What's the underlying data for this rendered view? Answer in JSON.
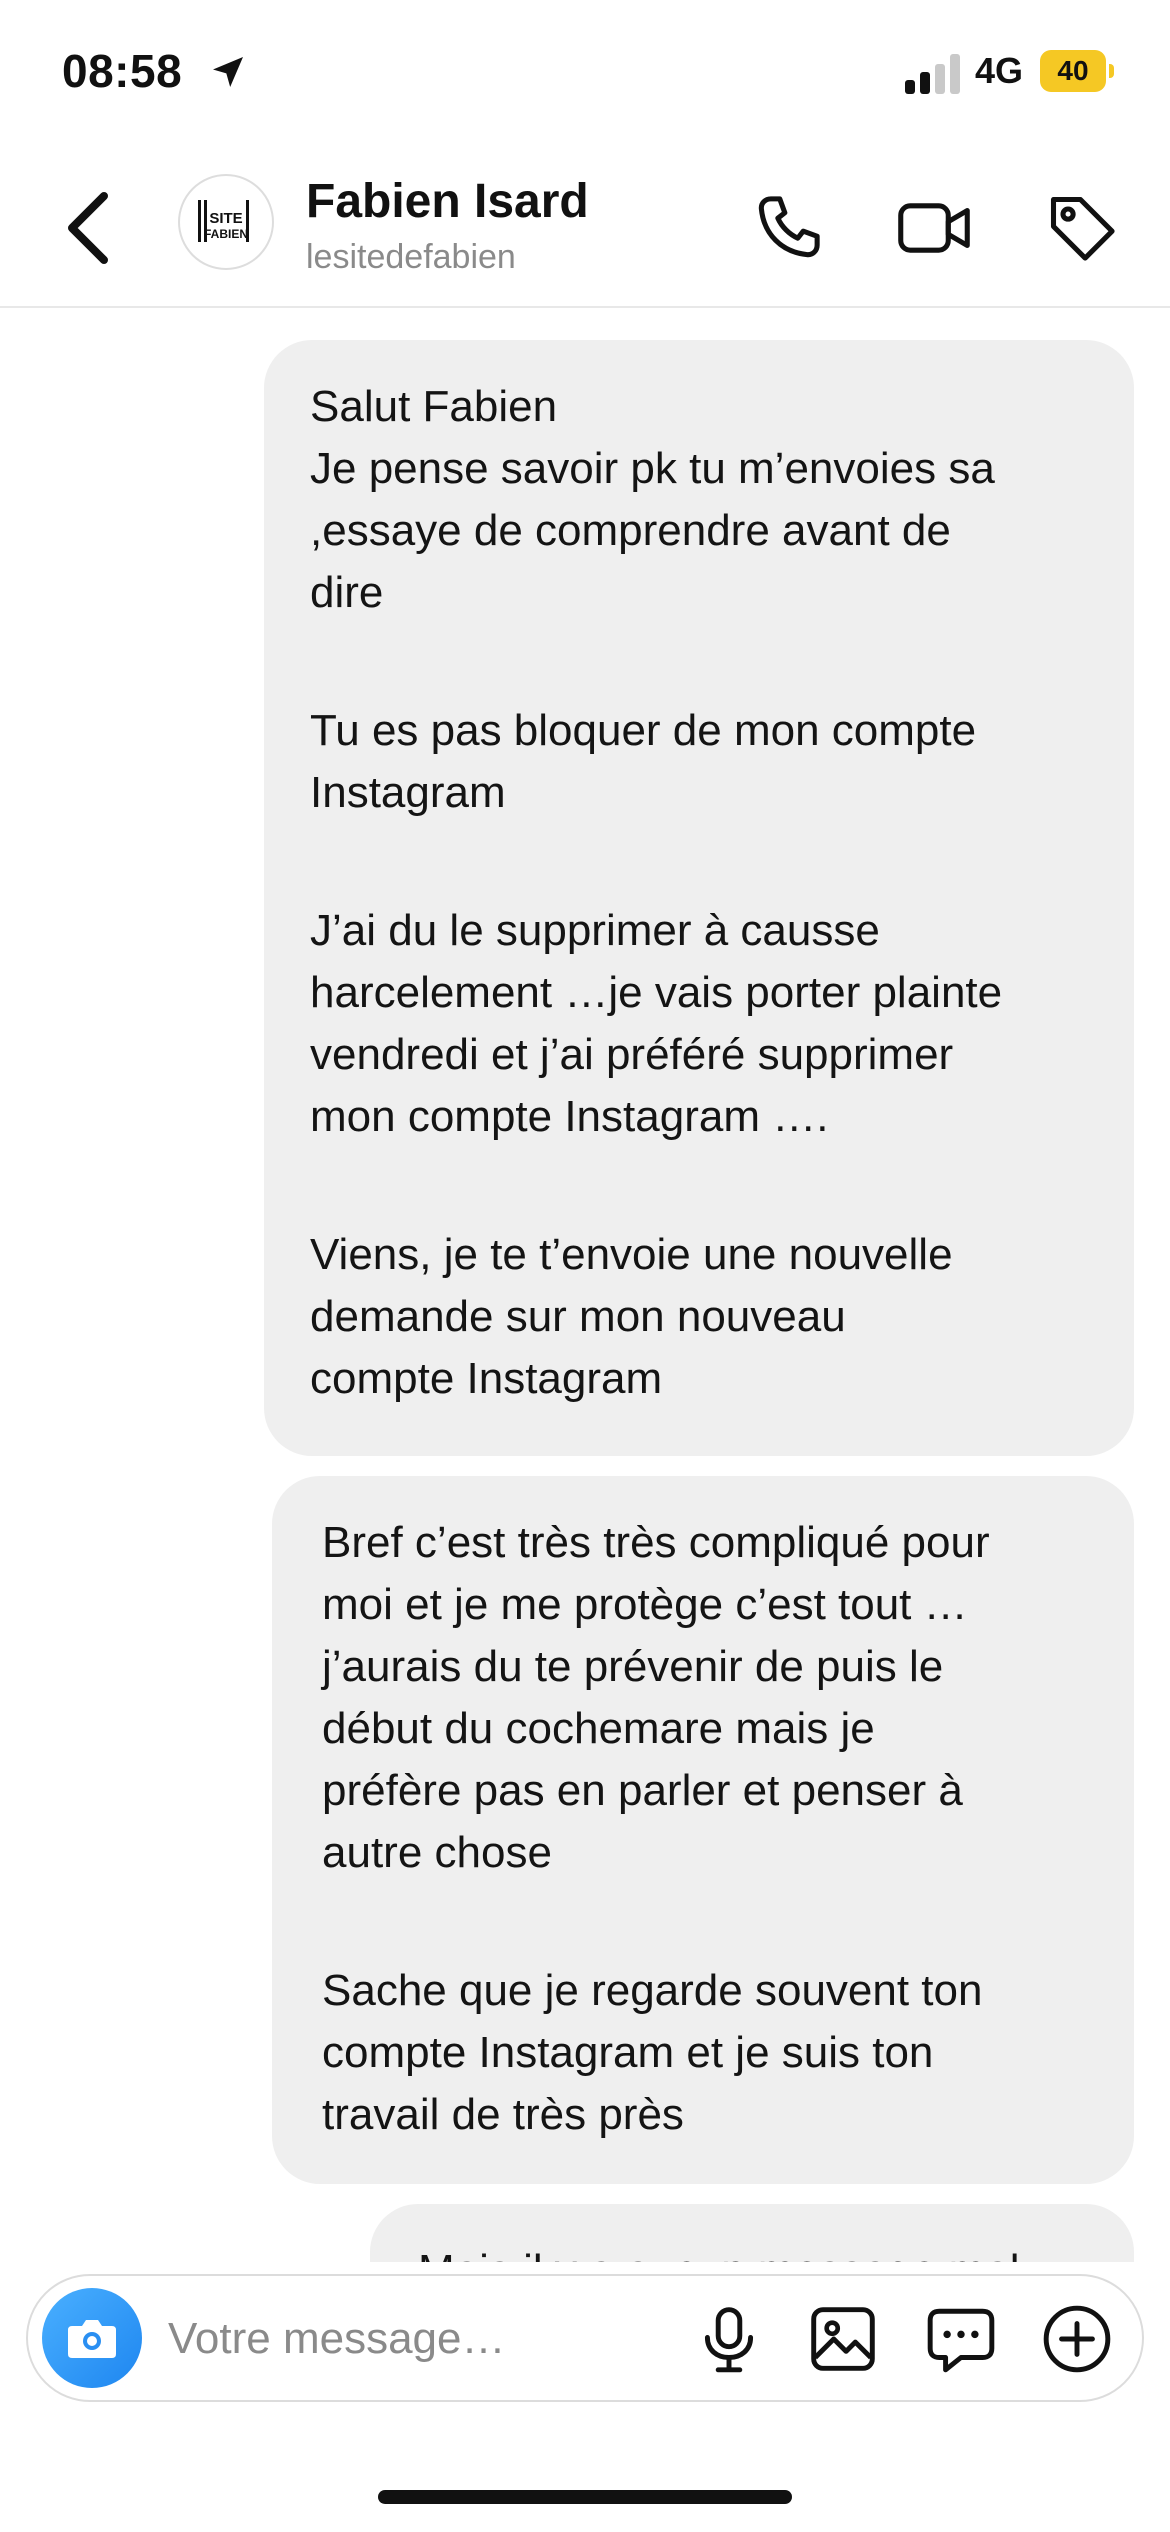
{
  "status": {
    "time": "08:58",
    "network": "4G",
    "battery": "40"
  },
  "header": {
    "name": "Fabien Isard",
    "handle": "lesitedefabien",
    "avatar_text_top": "SITE",
    "avatar_text_bottom": "FABIEN"
  },
  "messages": [
    {
      "paragraphs": [
        "Salut Fabien",
        "Je pense savoir pk tu m’envoies sa",
        ",essaye de comprendre avant de",
        "dire",
        "",
        "Tu es pas bloquer de mon compte",
        "Instagram",
        "",
        "J’ai du le supprimer à causse",
        "harcelement …je vais porter plainte",
        "vendredi et j’ai préféré supprimer",
        "mon compte Instagram ….",
        "",
        "Viens, je te t’envoie une nouvelle",
        "demande sur mon nouveau",
        "compte Instagram"
      ]
    },
    {
      "paragraphs": [
        "Bref c’est très très compliqué pour",
        "moi et je me protège c’est tout …",
        "j’aurais du te prévenir de puis le",
        "début du cochemare mais je",
        "préfère pas en parler et penser à",
        "autre chose",
        "",
        "Sache que je regarde souvent ton",
        "compte Instagram et je suis ton",
        "travail de très près"
      ]
    },
    {
      "paragraphs": [
        "Mais il y a aucun message mal"
      ]
    }
  ],
  "composer": {
    "placeholder": "Votre message…"
  },
  "icons": {
    "back": "chevron-left-icon",
    "call": "phone-icon",
    "video": "video-camera-icon",
    "tag": "tag-icon",
    "camera": "camera-icon",
    "mic": "microphone-icon",
    "gallery": "image-icon",
    "sticker": "chat-bubble-icon",
    "more": "plus-circle-icon"
  },
  "colors": {
    "bubble": "#efefef",
    "battery": "#f5c824",
    "camera": "#1e86f0"
  }
}
